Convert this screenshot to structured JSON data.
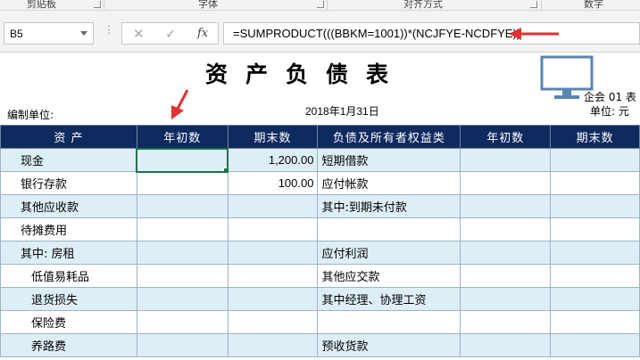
{
  "ribbon": {
    "groups": [
      "剪贴板",
      "字体",
      "对齐方式",
      "数字"
    ]
  },
  "formula_bar": {
    "name_box": "B5",
    "cancel_glyph": "✕",
    "enter_glyph": "✓",
    "fx_label": "fx",
    "formula": "=SUMPRODUCT(((BBKM=1001))*(NCJFYE-NCDFYE))"
  },
  "sheet": {
    "title": "资产负债表",
    "form_code": "企会 01 表",
    "unit_label": "单位:  元",
    "date": "2018年1月31日",
    "org_label": "编制单位:",
    "headers": [
      "资  产",
      "年初数",
      "期末数",
      "负债及所有者权益类",
      "年初数",
      "期末数"
    ],
    "rows": [
      {
        "asset": "现金",
        "a_begin": "",
        "a_end": "1,200.00",
        "liab": "短期借款",
        "l_begin": "",
        "l_end": ""
      },
      {
        "asset": "银行存款",
        "a_begin": "",
        "a_end": "100.00",
        "liab": "应付帐款",
        "l_begin": "",
        "l_end": ""
      },
      {
        "asset": "其他应收款",
        "a_begin": "",
        "a_end": "",
        "liab": "其中:到期未付款",
        "l_begin": "",
        "l_end": ""
      },
      {
        "asset": "待摊费用",
        "a_begin": "",
        "a_end": "",
        "liab": "",
        "l_begin": "",
        "l_end": ""
      },
      {
        "asset": "其中: 房租",
        "a_begin": "",
        "a_end": "",
        "liab": "应付利润",
        "l_begin": "",
        "l_end": ""
      },
      {
        "asset": "低值易耗品",
        "a_begin": "",
        "a_end": "",
        "liab": "其他应交款",
        "l_begin": "",
        "l_end": ""
      },
      {
        "asset": "退货损失",
        "a_begin": "",
        "a_end": "",
        "liab": "其中经理、协理工资",
        "l_begin": "",
        "l_end": ""
      },
      {
        "asset": "保险费",
        "a_begin": "",
        "a_end": "",
        "liab": "",
        "l_begin": "",
        "l_end": ""
      },
      {
        "asset": "养路费",
        "a_begin": "",
        "a_end": "",
        "liab": "预收货款",
        "l_begin": "",
        "l_end": ""
      }
    ]
  },
  "colors": {
    "header_bg": "#0f2a5f",
    "band_bg": "#deeef7",
    "selection": "#217346",
    "annotation_arrow": "#e03030",
    "monitor_icon": "#5b84b1"
  },
  "icons": {
    "monitor": "monitor-icon",
    "name_box_dropdown": "chevron-down-icon",
    "arrow_formula": "red-arrow-icon",
    "arrow_column": "red-arrow-icon"
  }
}
